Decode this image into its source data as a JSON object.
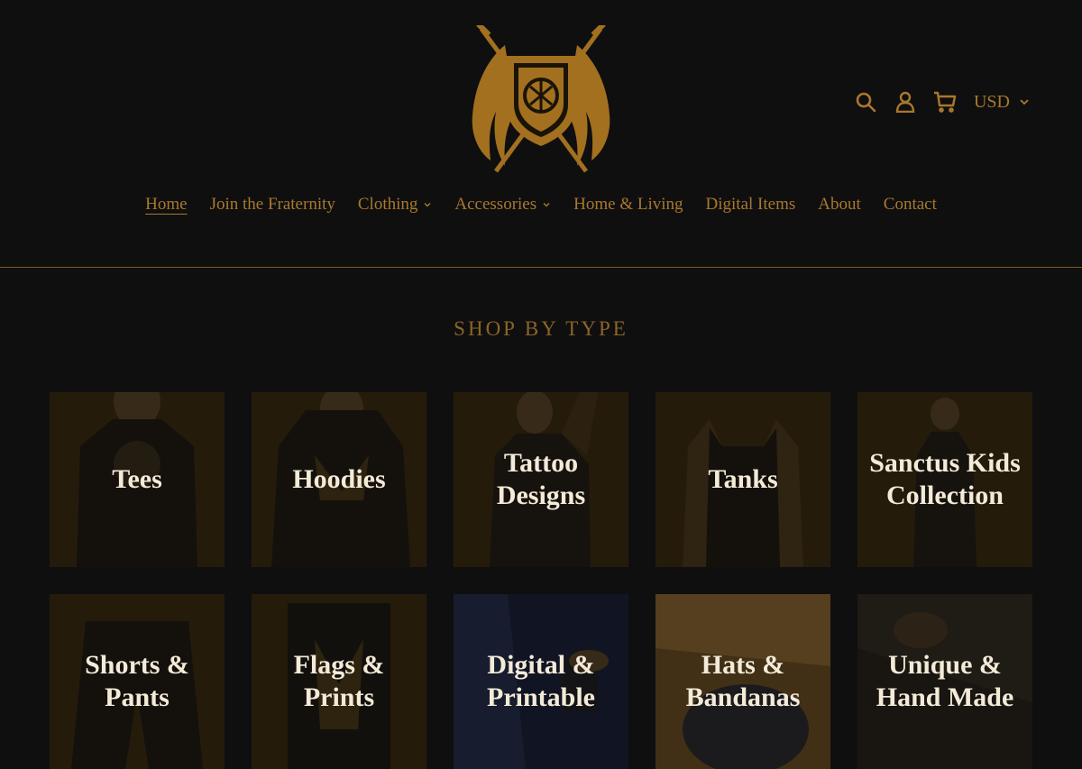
{
  "header": {
    "currency": "USD",
    "icons": [
      "search-icon",
      "account-icon",
      "cart-icon",
      "chevron-down-icon"
    ],
    "accent_color": "#a9782c"
  },
  "nav": {
    "items": [
      {
        "label": "Home",
        "active": true,
        "dropdown": false
      },
      {
        "label": "Join the Fraternity",
        "active": false,
        "dropdown": false
      },
      {
        "label": "Clothing",
        "active": false,
        "dropdown": true
      },
      {
        "label": "Accessories",
        "active": false,
        "dropdown": true
      },
      {
        "label": "Home & Living",
        "active": false,
        "dropdown": false
      },
      {
        "label": "Digital Items",
        "active": false,
        "dropdown": false
      },
      {
        "label": "About",
        "active": false,
        "dropdown": false
      },
      {
        "label": "Contact",
        "active": false,
        "dropdown": false
      }
    ]
  },
  "section": {
    "title": "SHOP BY TYPE"
  },
  "tiles": [
    {
      "label": "Tees"
    },
    {
      "label": "Hoodies"
    },
    {
      "label": "Tattoo Designs"
    },
    {
      "label": "Tanks"
    },
    {
      "label": "Sanctus Kids Collection"
    },
    {
      "label": "Shorts & Pants"
    },
    {
      "label": "Flags & Prints"
    },
    {
      "label": "Digital & Printable"
    },
    {
      "label": "Hats & Bandanas"
    },
    {
      "label": "Unique & Hand Made"
    }
  ]
}
